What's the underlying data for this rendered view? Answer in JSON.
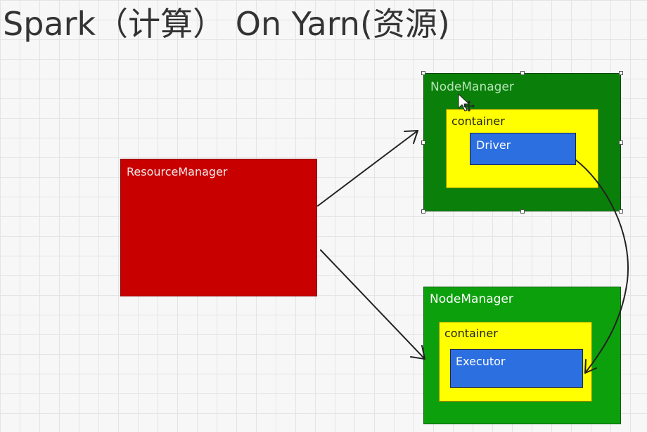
{
  "title": "Spark（计算） On Yarn(资源)",
  "resource_manager": {
    "label": "ResourceManager"
  },
  "node_manager_top": {
    "label": "NodeManager",
    "container": {
      "label": "container",
      "inner": {
        "label": "Driver"
      }
    }
  },
  "node_manager_bottom": {
    "label": "NodeManager",
    "container": {
      "label": "container",
      "inner": {
        "label": "Executor"
      }
    }
  },
  "colors": {
    "resource_manager": "#c80000",
    "node_manager_top": "#0a800a",
    "node_manager_bottom": "#0ca00c",
    "container": "#ffff00",
    "task": "#2c6fe0"
  }
}
